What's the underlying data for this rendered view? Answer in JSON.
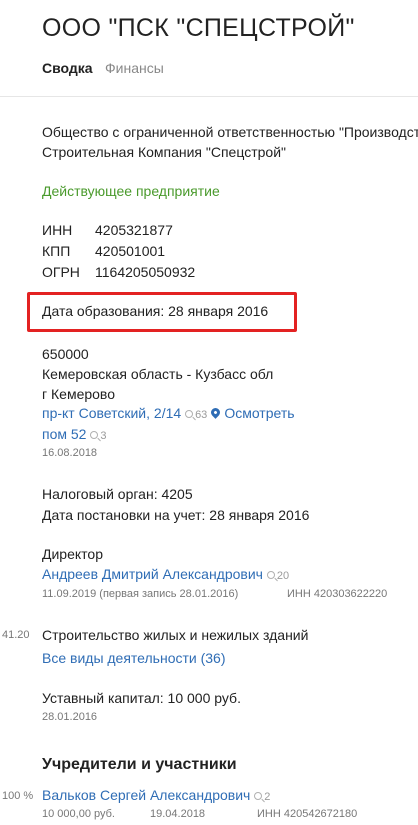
{
  "header": {
    "title": "ООО \"ПСК \"СПЕЦСТРОЙ\"",
    "tabs": [
      {
        "label": "Сводка"
      },
      {
        "label": "Финансы"
      }
    ]
  },
  "company": {
    "full_name_line1": "Общество с ограниченной ответственностью \"Производст",
    "full_name_line2": "Строительная Компания \"Спецстрой\"",
    "status": "Действующее предприятие",
    "ids": [
      {
        "label": "ИНН",
        "value": "4205321877"
      },
      {
        "label": "КПП",
        "value": "420501001"
      },
      {
        "label": "ОГРН",
        "value": "1164205050932"
      }
    ],
    "founded": "Дата образования: 28 января 2016"
  },
  "address": {
    "zip": "650000",
    "region": "Кемеровская область - Кузбасс обл",
    "city": "г Кемерово",
    "street": "пр-кт Советский, 2/14",
    "street_count": "63",
    "view_label": "Осмотреть",
    "room": "пом 52",
    "room_count": "3",
    "date": "16.08.2018"
  },
  "tax": {
    "authority": "Налоговый орган: 4205",
    "registered": "Дата постановки на учет: 28 января 2016"
  },
  "director": {
    "role": "Директор",
    "name": "Андреев Дмитрий Александрович",
    "count": "20",
    "date_info": "11.09.2019 (первая запись 28.01.2016)",
    "inn": "ИНН 420303622220"
  },
  "activity": {
    "code": "41.20",
    "name": "Строительство жилых и нежилых зданий",
    "all_link": "Все виды деятельности (36)"
  },
  "capital": {
    "text": "Уставный капитал: 10 000 руб.",
    "date": "28.01.2016"
  },
  "founders": {
    "heading": "Учредители и участники",
    "items": [
      {
        "share": "100 %",
        "name": "Вальков Сергей Александрович",
        "count": "2",
        "amount": "10 000,00 руб.",
        "date": "19.04.2018",
        "inn": "ИНН 420542672180"
      }
    ]
  },
  "colors": {
    "link": "#2f6db5",
    "status_green": "#4a9a2c",
    "highlight": "#e32222"
  }
}
